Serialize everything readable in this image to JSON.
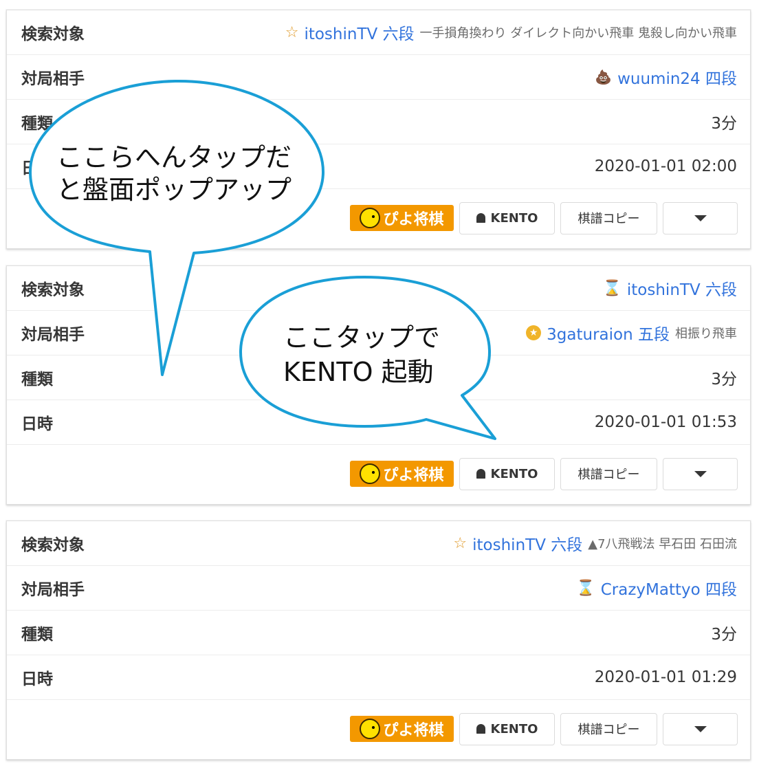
{
  "labels": {
    "search": "検索対象",
    "opponent": "対局相手",
    "kind": "種類",
    "datetime": "日時"
  },
  "buttons": {
    "piyo": "ぴよ将棋",
    "kento": "KENTO",
    "copy": "棋譜コピー"
  },
  "cards": [
    {
      "search_icon": "☆",
      "search_name": "itoshinTV 六段",
      "search_tags": "一手損角換わり ダイレクト向かい飛車 鬼殺し向かい飛車",
      "opp_icon": "💩",
      "opp_name": "wuumin24 四段",
      "opp_tags": "",
      "kind": "3分",
      "datetime": "2020-01-01 02:00"
    },
    {
      "search_icon": "⌛",
      "search_name": "itoshinTV 六段",
      "search_tags": "",
      "opp_icon": "★",
      "opp_name": "3gaturaion 五段",
      "opp_tags": "相振り飛車",
      "kind": "3分",
      "datetime": "2020-01-01 01:53"
    },
    {
      "search_icon": "☆",
      "search_name": "itoshinTV 六段",
      "search_tags": "▲7八飛戦法 早石田 石田流",
      "opp_icon": "⌛",
      "opp_name": "CrazyMattyo 四段",
      "opp_tags": "",
      "kind": "3分",
      "datetime": "2020-01-01 01:29"
    }
  ],
  "bubbles": {
    "one_line1": "ここらへんタップだ",
    "one_line2": "と盤面ポップアップ",
    "two_line1": "ここタップで",
    "two_line2": "KENTO 起動"
  },
  "colors": {
    "link": "#3273dc",
    "piyo": "#f39800",
    "bubble_stroke": "#1a9fd6"
  }
}
